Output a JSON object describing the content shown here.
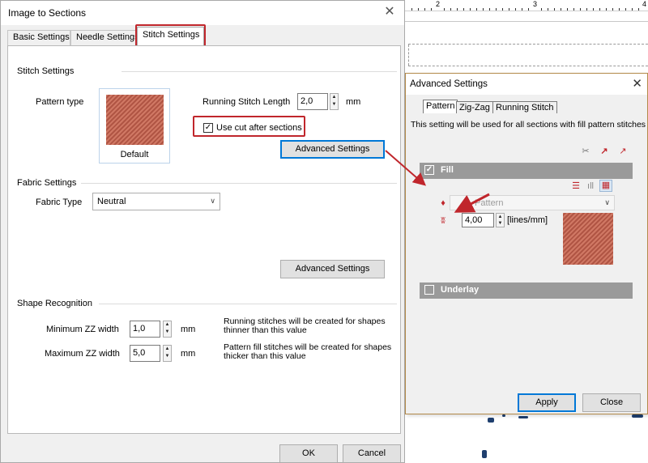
{
  "main_dialog": {
    "title": "Image to Sections",
    "tabs": [
      {
        "label": "Basic Settings"
      },
      {
        "label": "Needle Settings"
      },
      {
        "label": "Stitch Settings"
      }
    ],
    "stitch_settings": {
      "group_title": "Stitch Settings",
      "pattern_type_label": "Pattern type",
      "pattern_name": "Default",
      "running_stitch_length_label": "Running Stitch Length",
      "running_stitch_length_value": "2,0",
      "running_stitch_length_unit": "mm",
      "use_cut_label": "Use cut after sections",
      "use_cut_checked": true,
      "advanced_button": "Advanced Settings"
    },
    "fabric_settings": {
      "group_title": "Fabric Settings",
      "fabric_type_label": "Fabric Type",
      "fabric_type_value": "Neutral",
      "advanced_button": "Advanced Settings"
    },
    "shape_recognition": {
      "group_title": "Shape Recognition",
      "min_label": "Minimum ZZ width",
      "min_value": "1,0",
      "min_unit": "mm",
      "min_desc": "Running stitches will be created for shapes thinner than this value",
      "max_label": "Maximum ZZ width",
      "max_value": "5,0",
      "max_unit": "mm",
      "max_desc": "Pattern fill stitches will be created for shapes thicker than this value"
    },
    "ok_button": "OK",
    "cancel_button": "Cancel"
  },
  "advanced_dialog": {
    "title": "Advanced Settings",
    "tabs": [
      {
        "label": "Pattern"
      },
      {
        "label": "Zig-Zag"
      },
      {
        "label": "Running Stitch"
      }
    ],
    "info": "This setting will be used for all sections with fill pattern stitches",
    "fill_label": "Fill",
    "fill_checked": true,
    "pattern_select": "Pattern",
    "density_value": "4,00",
    "density_unit": "[lines/mm]",
    "underlay_label": "Underlay",
    "underlay_checked": false,
    "apply_button": "Apply",
    "close_button": "Close"
  },
  "ruler": {
    "numbers": [
      "2",
      "3",
      "4"
    ]
  },
  "colors": {
    "highlight": "#c0262c",
    "focus_blue": "#0078d7",
    "pattern_swatch": "#c4644f",
    "section_bar": "#9a9a9a"
  }
}
